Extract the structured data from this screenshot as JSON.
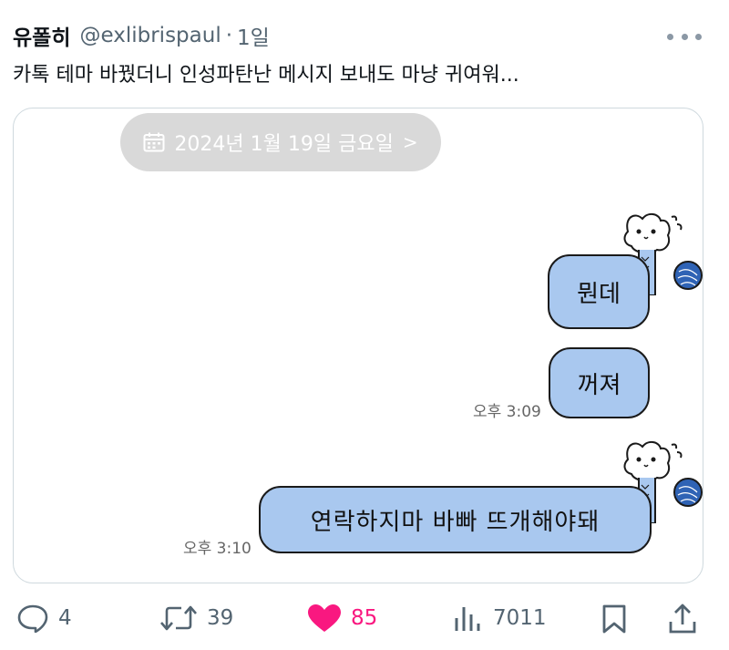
{
  "post": {
    "author_name": "유폴히",
    "author_handle": "@exlibrispaul",
    "separator": "·",
    "time": "1일",
    "text": "카톡 테마 바꿨더니 인성파탄난 메시지 보내도 마냥 귀여워..."
  },
  "chat": {
    "date_label": "2024년 1월 19일 금요일",
    "chevron": ">",
    "messages": [
      {
        "text": "뭔데",
        "time": ""
      },
      {
        "text": "꺼져",
        "time": "오후 3:09"
      },
      {
        "text": "연락하지마 바빠 뜨개해야돼",
        "time": "오후 3:10"
      }
    ],
    "bubble_color": "#a9c8ef"
  },
  "actions": {
    "replies": "4",
    "retweets": "39",
    "likes": "85",
    "views": "7011",
    "like_color": "#f91880"
  },
  "icons": [
    "more-icon",
    "calendar-icon",
    "reply-icon",
    "retweet-icon",
    "heart-icon",
    "views-icon",
    "bookmark-icon",
    "share-icon"
  ]
}
